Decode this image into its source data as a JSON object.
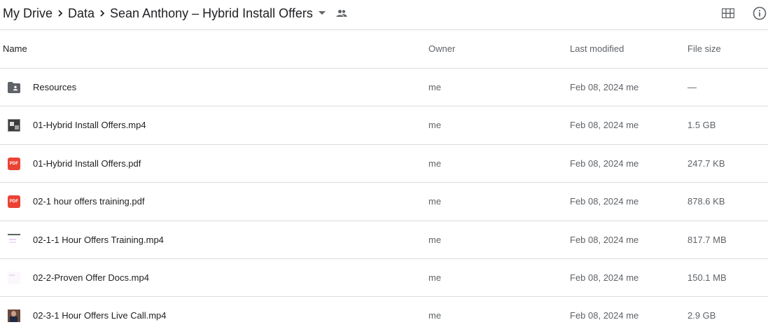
{
  "breadcrumb": {
    "items": [
      "My Drive",
      "Data"
    ],
    "current": "Sean Anthony – Hybrid Install Offers"
  },
  "toolbar": {
    "grid_icon": "grid-view-icon",
    "info_icon": "info-icon"
  },
  "columns": {
    "name": "Name",
    "owner": "Owner",
    "last_modified": "Last modified",
    "file_size": "File size"
  },
  "files": [
    {
      "name": "Resources",
      "owner": "me",
      "modified": "Feb 08, 2024 me",
      "size": "—",
      "icon": "shared-folder-icon"
    },
    {
      "name": "01-Hybrid Install Offers.mp4",
      "owner": "me",
      "modified": "Feb 08, 2024 me",
      "size": "1.5 GB",
      "icon": "video-thumbnail-icon"
    },
    {
      "name": "01-Hybrid Install Offers.pdf",
      "owner": "me",
      "modified": "Feb 08, 2024 me",
      "size": "247.7 KB",
      "icon": "pdf-icon",
      "icon_text": "PDF"
    },
    {
      "name": "02-1 hour offers training.pdf",
      "owner": "me",
      "modified": "Feb 08, 2024 me",
      "size": "878.6 KB",
      "icon": "pdf-icon",
      "icon_text": "PDF"
    },
    {
      "name": "02-1-1 Hour Offers Training.mp4",
      "owner": "me",
      "modified": "Feb 08, 2024 me",
      "size": "817.7 MB",
      "icon": "video-thumbnail-icon"
    },
    {
      "name": "02-2-Proven Offer Docs.mp4",
      "owner": "me",
      "modified": "Feb 08, 2024 me",
      "size": "150.1 MB",
      "icon": "video-thumbnail-icon"
    },
    {
      "name": "02-3-1 Hour Offers Live Call.mp4",
      "owner": "me",
      "modified": "Feb 08, 2024 me",
      "size": "2.9 GB",
      "icon": "video-thumbnail-icon"
    }
  ],
  "colors": {
    "text": "#202124",
    "muted": "#5f6368",
    "divider": "#dadce0",
    "pdf_red": "#ea4335"
  }
}
